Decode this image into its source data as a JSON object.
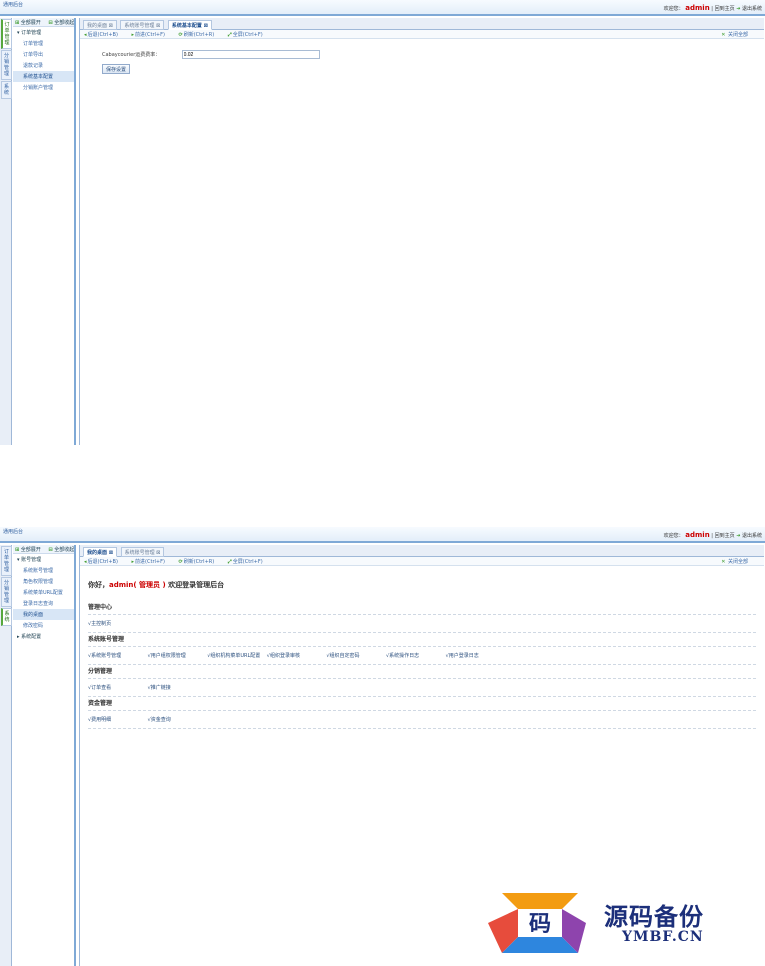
{
  "screen1": {
    "app_title": "通用后台",
    "header": {
      "welcome": "欢迎您：",
      "user": "admin",
      "sep": "|",
      "role_link": "回到主页",
      "exit": "退出系统"
    },
    "vtabs": [
      {
        "label": "订单管理",
        "active": true
      },
      {
        "label": "分销管理",
        "active": false
      },
      {
        "label": "系统",
        "active": false
      }
    ],
    "tree_toolbar": {
      "expand": "全部展开",
      "collapse": "全部收起"
    },
    "tree": {
      "group": "订单管理",
      "items": [
        {
          "label": "订单管理",
          "selected": false
        },
        {
          "label": "订单导出",
          "selected": false
        },
        {
          "label": "退款记录",
          "selected": false
        },
        {
          "label": "系统基本配置",
          "selected": true
        },
        {
          "label": "分销账户管理",
          "selected": false
        }
      ]
    },
    "tabs": [
      {
        "label": "我的桌面",
        "active": false
      },
      {
        "label": "系统账号管理",
        "active": false
      },
      {
        "label": "系统基本配置",
        "active": true
      }
    ],
    "toolbar": {
      "back": "后退(Ctrl+B)",
      "forward": "前进(Ctrl+F)",
      "refresh": "刷新(Ctrl+R)",
      "fullscreen": "全屏(Ctrl+F)",
      "close_all": "关闭全部"
    },
    "form": {
      "label": "Cabaycourier运费费率：",
      "value": "0.02",
      "save": "保存设置"
    }
  },
  "screen2": {
    "app_title": "通用后台",
    "header": {
      "welcome": "欢迎您：",
      "user": "admin",
      "sep": "|",
      "role_link": "回到主页",
      "exit": "退出系统"
    },
    "vtabs": [
      {
        "label": "订单管理",
        "active": false
      },
      {
        "label": "分销管理",
        "active": false
      },
      {
        "label": "系统",
        "active": true
      }
    ],
    "tree_toolbar": {
      "expand": "全部展开",
      "collapse": "全部收起"
    },
    "tree": {
      "group": "账号管理",
      "items": [
        {
          "label": "系统账号管理",
          "selected": false
        },
        {
          "label": "角色权限管理",
          "selected": false
        },
        {
          "label": "系统菜单URL配置",
          "selected": false
        },
        {
          "label": "登录日志查询",
          "selected": false
        },
        {
          "label": "我的桌面",
          "selected": true
        },
        {
          "label": "修改密码",
          "selected": false
        }
      ],
      "group2": "系统配置"
    },
    "tabs": [
      {
        "label": "我的桌面",
        "active": true
      },
      {
        "label": "系统账号管理",
        "active": false
      }
    ],
    "toolbar": {
      "back": "后退(Ctrl+B)",
      "forward": "前进(Ctrl+F)",
      "refresh": "刷新(Ctrl+R)",
      "fullscreen": "全屏(Ctrl+F)",
      "close_all": "关闭全部"
    },
    "greeting": {
      "prefix": "你好，",
      "user": "admin",
      "role": "( 管理员 )",
      "suffix": " 欢迎登录管理后台"
    },
    "sections": [
      {
        "title": "管理中心",
        "links": [
          "√主控制页"
        ]
      },
      {
        "title": "系统账号管理",
        "links": [
          "√系统账号管理",
          "√用户组权限管理",
          "√组织机构菜单URL配置",
          "√组织登录审核",
          "√组织自定密码",
          "√系统操作日志",
          "√用户登录日志"
        ]
      },
      {
        "title": "分销管理",
        "links": [
          "√订单查看",
          "√推广链接"
        ]
      },
      {
        "title": "资金管理",
        "links": [
          "√费用明细",
          "√资金查询"
        ]
      }
    ]
  },
  "watermark": {
    "zh": "源码备份",
    "en": "YMBF.CN",
    "glyph": "码"
  }
}
